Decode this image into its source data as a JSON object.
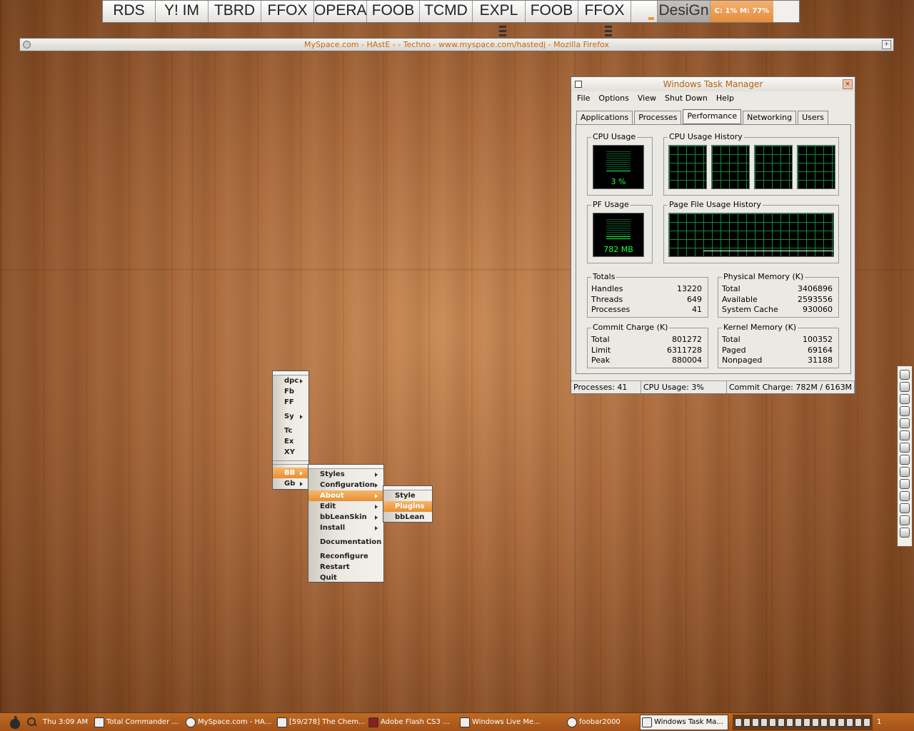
{
  "launcher": {
    "buttons": [
      "RDS",
      "Y! IM",
      "TBRD",
      "FFOX",
      "OPERA",
      "FOOB",
      "TCMD",
      "EXPL",
      "FOOB",
      "FFOX",
      "DesiGn"
    ],
    "sysmon": "C: 1%  M: 77%"
  },
  "firefox": {
    "title": "MySpace.com - HAstE -  - Techno  - www.myspace.com/hastedj - Mozilla Firefox"
  },
  "taskmgr": {
    "title": "Windows Task Manager",
    "menu": [
      "File",
      "Options",
      "View",
      "Shut Down",
      "Help"
    ],
    "tabs": [
      "Applications",
      "Processes",
      "Performance",
      "Networking",
      "Users"
    ],
    "active_tab": "Performance",
    "cpu_usage_label": "CPU Usage",
    "cpu_usage_value": "3 %",
    "cpu_usage_percent": 3,
    "cpu_history_label": "CPU Usage History",
    "pf_usage_label": "PF Usage",
    "pf_usage_value": "782 MB",
    "pf_usage_fraction": 0.12,
    "pf_history_label": "Page File Usage History",
    "totals": {
      "label": "Totals",
      "rows": [
        [
          "Handles",
          "13220"
        ],
        [
          "Threads",
          "649"
        ],
        [
          "Processes",
          "41"
        ]
      ]
    },
    "physical": {
      "label": "Physical Memory (K)",
      "rows": [
        [
          "Total",
          "3406896"
        ],
        [
          "Available",
          "2593556"
        ],
        [
          "System Cache",
          "930060"
        ]
      ]
    },
    "commit": {
      "label": "Commit Charge (K)",
      "rows": [
        [
          "Total",
          "801272"
        ],
        [
          "Limit",
          "6311728"
        ],
        [
          "Peak",
          "880004"
        ]
      ]
    },
    "kernel": {
      "label": "Kernel Memory (K)",
      "rows": [
        [
          "Total",
          "100352"
        ],
        [
          "Paged",
          "69164"
        ],
        [
          "Nonpaged",
          "31188"
        ]
      ]
    },
    "status": [
      "Processes: 41",
      "CPU Usage: 3%",
      "Commit Charge: 782M / 6163M"
    ]
  },
  "menus": {
    "main": [
      "dpc",
      "Fb",
      "FF",
      "Sy",
      "Tc",
      "Ex",
      "XY",
      "BB",
      "Gb"
    ],
    "bb": [
      "Styles",
      "Configuration",
      "About",
      "Edit",
      "bbLeanSkin",
      "Install",
      "Documentation",
      "Reconfigure",
      "Restart",
      "Quit"
    ],
    "about": [
      "Style",
      "Plugins",
      "bbLean"
    ]
  },
  "taskbar": {
    "clock": "Thu 3:09 AM",
    "tasks": [
      "Total Commander ...",
      "MySpace.com - HA...",
      "[59/278] The Chem...",
      "Adobe Flash CS3 ...",
      "Windows Live Me...",
      "foobar2000",
      "Windows Task Ma..."
    ],
    "active_task": "Windows Task Ma...",
    "tray_count": "1"
  }
}
